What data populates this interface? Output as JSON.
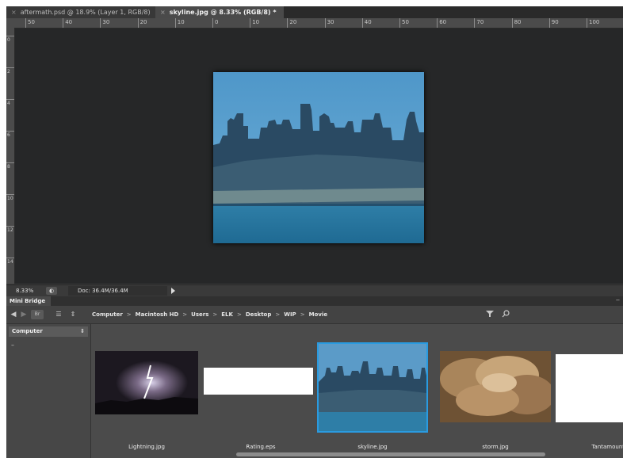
{
  "tabs": [
    {
      "close": "×",
      "label": "aftermath.psd @ 18.9% (Layer 1, RGB/8)"
    },
    {
      "close": "×",
      "label": "skyline.jpg @ 8.33% (RGB/8) *"
    }
  ],
  "ruler_top_labels": [
    "50",
    "40",
    "30",
    "20",
    "10",
    "0",
    "10",
    "20",
    "30",
    "40",
    "50",
    "60",
    "70",
    "80",
    "90",
    "100"
  ],
  "ruler_left_labels": [
    "0",
    "2",
    "4",
    "6",
    "8",
    "10",
    "12",
    "14"
  ],
  "status": {
    "zoom": "8.33%",
    "doc_info": "Doc: 36.4M/36.4M"
  },
  "mini_bridge": {
    "panel_title": "Mini Bridge",
    "path": [
      "Computer",
      "Macintosh HD",
      "Users",
      "ELK",
      "Desktop",
      "WIP",
      "Movie"
    ],
    "sidebar_select": "Computer",
    "sidebar_item": "–",
    "thumbnails": [
      {
        "name": "Lightning.jpg"
      },
      {
        "name": "Rating.eps"
      },
      {
        "name": "skyline.jpg"
      },
      {
        "name": "storm.jpg"
      },
      {
        "name": "Tantamount.ep"
      }
    ]
  }
}
